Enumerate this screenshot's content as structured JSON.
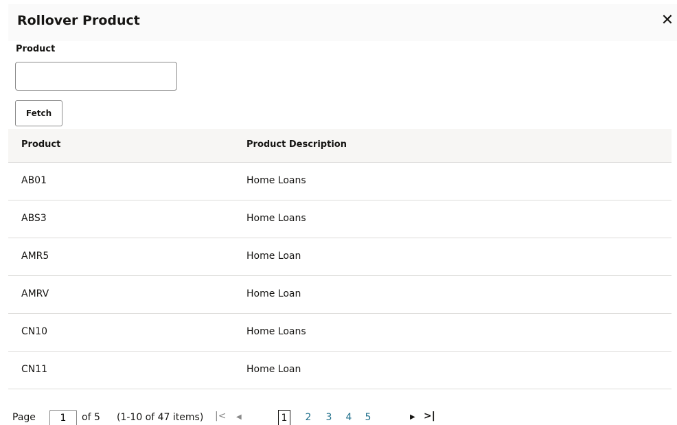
{
  "dialog": {
    "title": "Rollover Product",
    "close_icon": "close-icon",
    "close_glyph": "✕"
  },
  "search": {
    "label": "Product",
    "value": "",
    "placeholder": "",
    "fetch_label": "Fetch"
  },
  "table": {
    "headers": [
      "Product",
      "Product Description"
    ],
    "rows": [
      [
        "AB01",
        "Home Loans"
      ],
      [
        "ABS3",
        "Home Loans"
      ],
      [
        "AMR5",
        "Home Loan"
      ],
      [
        "AMRV",
        "Home Loan"
      ],
      [
        "CN10",
        "Home Loans"
      ],
      [
        "CN11",
        "Home Loan"
      ]
    ]
  },
  "pagination": {
    "page_label": "Page",
    "current_page": "1",
    "of_label": "of 5",
    "items_label": "(1-10 of 47 items)",
    "first_icon": "first-page-icon",
    "first_glyph": "|<",
    "prev_icon": "prev-page-icon",
    "prev_glyph": "◀",
    "pages": [
      "1",
      "2",
      "3",
      "4",
      "5"
    ],
    "next_icon": "next-page-icon",
    "next_glyph": "▶",
    "last_icon": "last-page-icon",
    "last_glyph": ">|"
  },
  "colors": {
    "link": "#1f6f8b",
    "header_bg": "#fafafa",
    "table_header_bg": "#f7f6f4",
    "border": "#dcdbd9"
  }
}
